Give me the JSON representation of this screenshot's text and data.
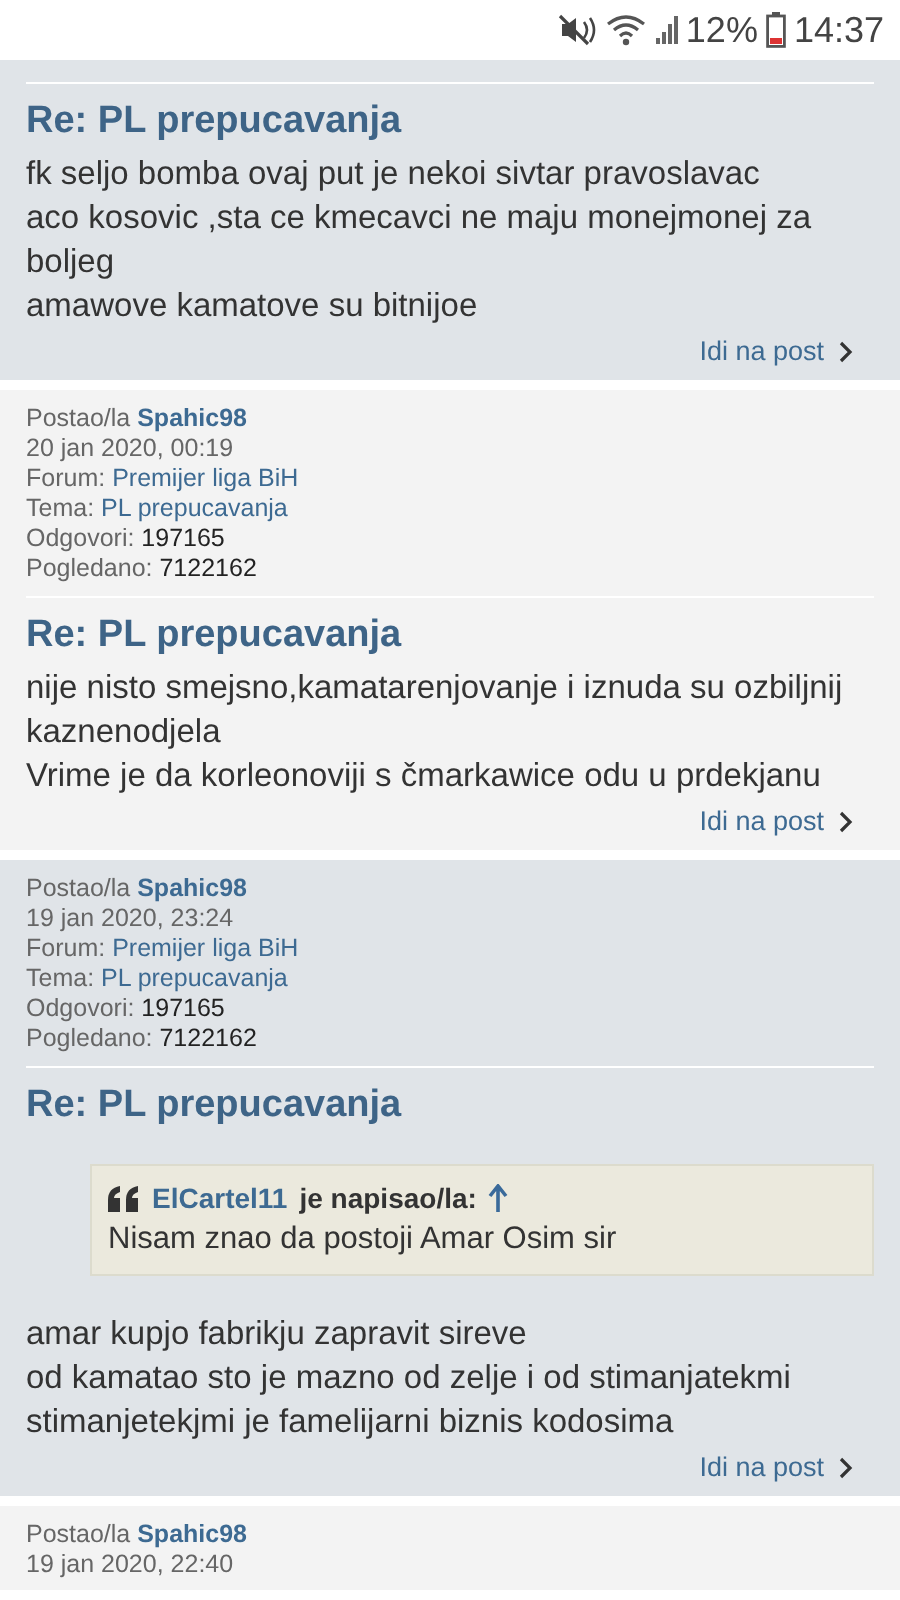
{
  "status_bar": {
    "battery": "12%",
    "time": "14:37"
  },
  "posts": [
    {
      "shaded": true,
      "title": "Re: PL prepucavanja",
      "body": [
        "fk seljo bomba ovaj put je nekoi sivtar pravoslavac",
        "aco kosovic ,sta ce kmecavci ne maju monejmonej za boljeg",
        "amawove kamatove su bitnijoe"
      ],
      "link": "Idi na post"
    },
    {
      "shaded": false,
      "meta": {
        "author_label": "Postao/la",
        "author": "Spahic98",
        "date": "20 jan 2020, 00:19",
        "forum_label": "Forum:",
        "forum": "Premijer liga BiH",
        "topic_label": "Tema:",
        "topic": "PL prepucavanja",
        "replies_label": "Odgovori:",
        "replies": "197165",
        "views_label": "Pogledano:",
        "views": "7122162"
      },
      "title": "Re: PL prepucavanja",
      "body": [
        "nije nisto smejsno,kamatarenjovanje i iznuda su ozbiljnij kaznenodjela",
        "Vrime je da korleonoviji s čmarkawice odu u prdekjanu"
      ],
      "link": "Idi na post"
    },
    {
      "shaded": true,
      "meta": {
        "author_label": "Postao/la",
        "author": "Spahic98",
        "date": "19 jan 2020, 23:24",
        "forum_label": "Forum:",
        "forum": "Premijer liga BiH",
        "topic_label": "Tema:",
        "topic": "PL prepucavanja",
        "replies_label": "Odgovori:",
        "replies": "197165",
        "views_label": "Pogledano:",
        "views": "7122162"
      },
      "title": "Re: PL prepucavanja",
      "quote": {
        "author": "ElCartel11",
        "wrote": "je napisao/la:",
        "text": "Nisam znao da postoji Amar Osim sir"
      },
      "body": [
        "amar kupjo fabrikju zapravit sireve",
        "od kamatao sto je mazno od zelje i od stimanjatekmi",
        "stimanjetekjmi je famelijarni biznis kodosima"
      ],
      "link": "Idi na post"
    },
    {
      "shaded": false,
      "meta": {
        "author_label": "Postao/la",
        "author": "Spahic98",
        "date": "19 jan 2020, 22:40"
      }
    }
  ]
}
